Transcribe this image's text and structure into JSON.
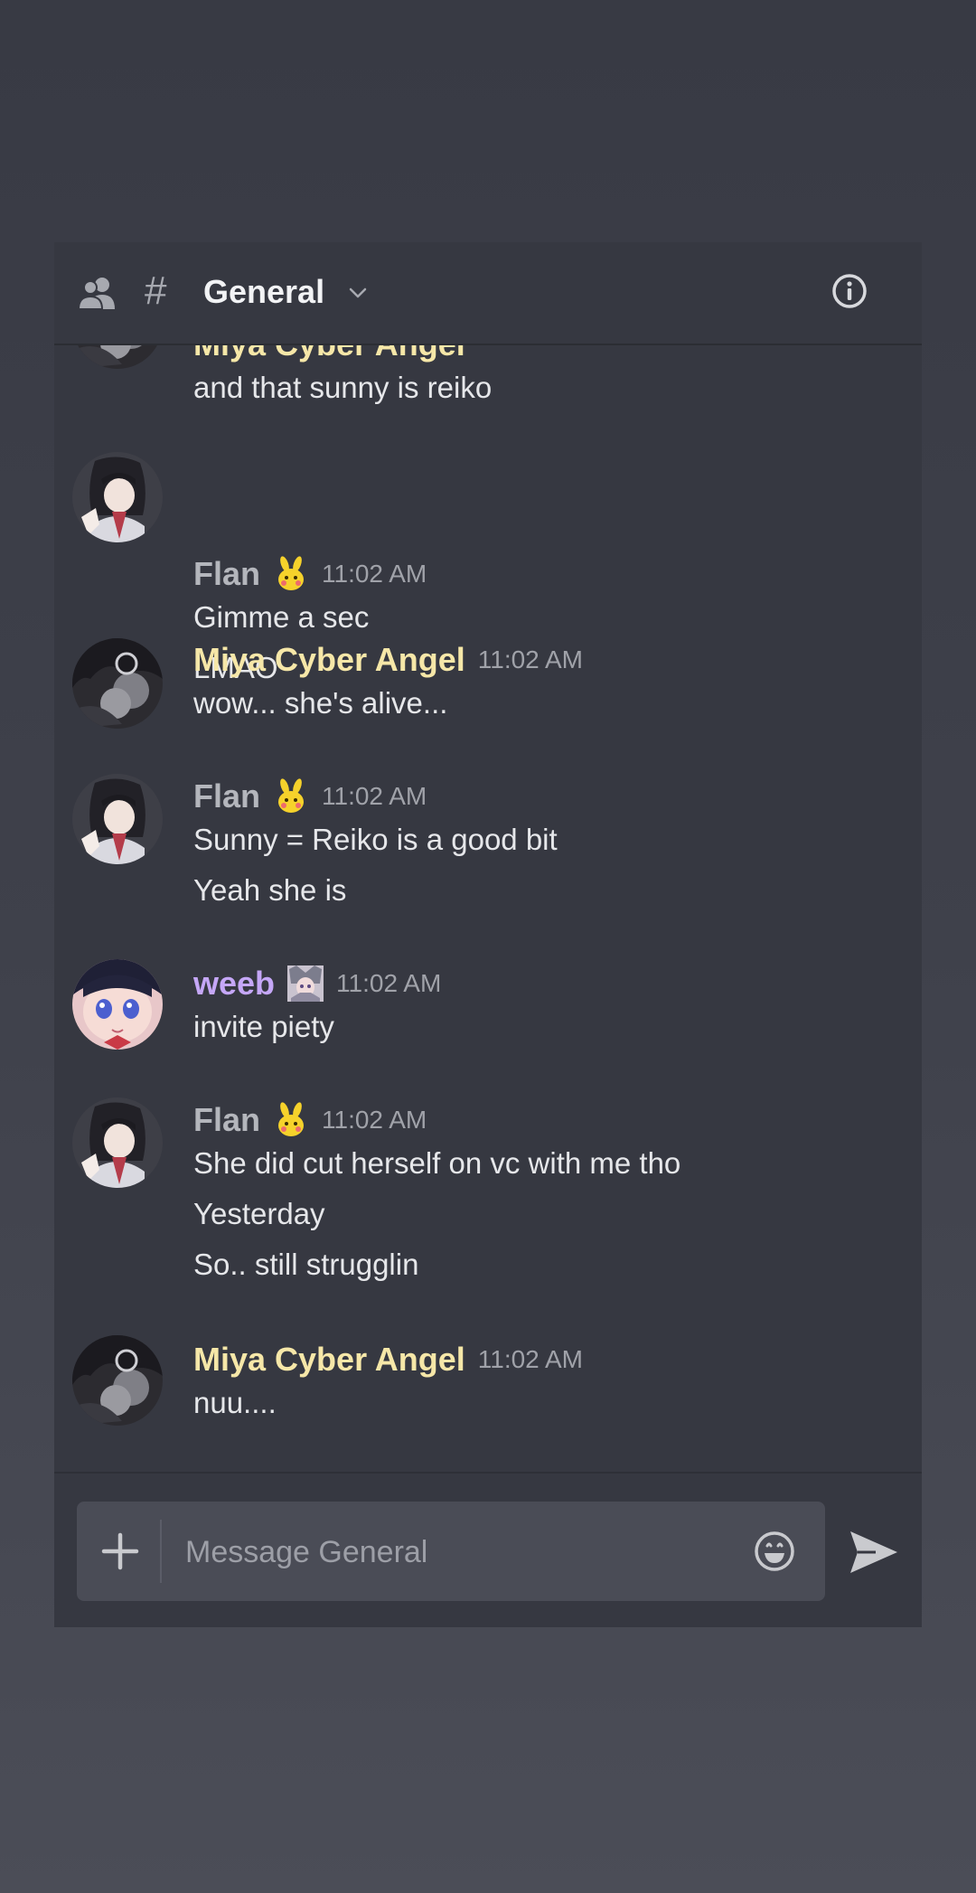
{
  "header": {
    "members_icon": "members-icon",
    "hash": "#",
    "title": "General",
    "chevron_icon": "chevron-down-icon",
    "info_icon": "info-icon"
  },
  "partial_message": {
    "username_cut": "Miya Cyber Angel",
    "lines": [
      "and that sunny is reiko"
    ]
  },
  "messages": [
    {
      "username": "Flan",
      "name_color": "#b4b6bc",
      "badge": "bunny-emoji-badge",
      "time": "11:02 AM",
      "lines": [
        "Gimme a sec",
        "LMAO"
      ]
    },
    {
      "username": "Miya Cyber Angel",
      "name_color": "#f6e7a8",
      "time": "11:02 AM",
      "lines": [
        "wow... she's alive..."
      ]
    },
    {
      "username": "Flan",
      "name_color": "#b4b6bc",
      "badge": "bunny-emoji-badge",
      "time": "11:02 AM",
      "lines": [
        "Sunny = Reiko is a good bit",
        "Yeah she is"
      ]
    },
    {
      "username": "weeb",
      "name_color": "#c5a7f7",
      "badge": "anime-girl-badge",
      "time": "11:02 AM",
      "lines": [
        "invite piety"
      ]
    },
    {
      "username": "Flan",
      "name_color": "#b4b6bc",
      "badge": "bunny-emoji-badge",
      "time": "11:02 AM",
      "lines": [
        "She did cut herself on vc with me tho",
        "Yesterday",
        "So.. still strugglin"
      ]
    },
    {
      "username": "Miya Cyber Angel",
      "name_color": "#f6e7a8",
      "time": "11:02 AM",
      "lines": [
        "nuu...."
      ]
    }
  ],
  "composer": {
    "plus_icon": "plus-icon",
    "placeholder": "Message General",
    "emoji_icon": "emoji-icon",
    "send_icon": "send-icon"
  },
  "colors": {
    "background": "#363841",
    "page_background": "#3f414b",
    "input_background": "#4a4c56",
    "text": "#e6e7ea",
    "timestamp": "#a0a2a9"
  }
}
